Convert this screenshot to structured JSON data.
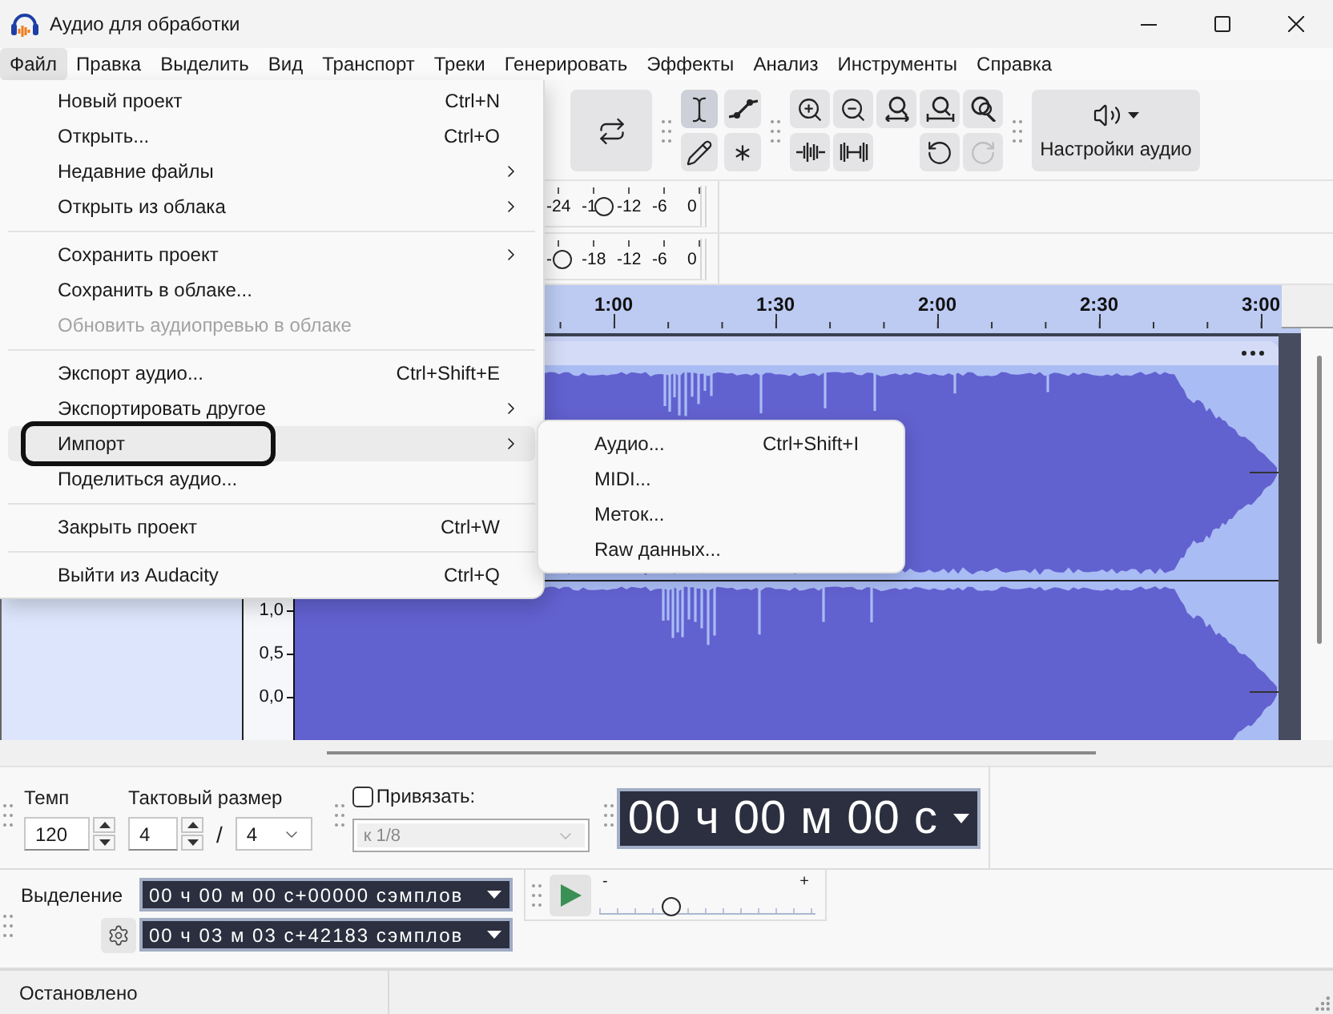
{
  "window": {
    "title": "Аудио для обработки"
  },
  "menu_bar": [
    {
      "label": "Файл",
      "selected": true
    },
    {
      "label": "Правка",
      "selected": false
    },
    {
      "label": "Выделить",
      "selected": false
    },
    {
      "label": "Вид",
      "selected": false
    },
    {
      "label": "Транспорт",
      "selected": false
    },
    {
      "label": "Треки",
      "selected": false
    },
    {
      "label": "Генерировать",
      "selected": false
    },
    {
      "label": "Эффекты",
      "selected": false
    },
    {
      "label": "Анализ",
      "selected": false
    },
    {
      "label": "Инструменты",
      "selected": false
    },
    {
      "label": "Справка",
      "selected": false
    }
  ],
  "file_menu": {
    "items": [
      {
        "kind": "item",
        "label": "Новый проект",
        "shortcut": "Ctrl+N",
        "submenu": false,
        "disabled": false,
        "selected": false,
        "outlined": false
      },
      {
        "kind": "item",
        "label": "Открыть...",
        "shortcut": "Ctrl+O",
        "submenu": false,
        "disabled": false,
        "selected": false,
        "outlined": false
      },
      {
        "kind": "item",
        "label": "Недавние файлы",
        "submenu": true,
        "disabled": false,
        "selected": false,
        "outlined": false
      },
      {
        "kind": "item",
        "label": "Открыть из облака",
        "submenu": true,
        "disabled": false,
        "selected": false,
        "outlined": false
      },
      {
        "kind": "separator"
      },
      {
        "kind": "item",
        "label": "Сохранить проект",
        "submenu": true,
        "disabled": false,
        "selected": false,
        "outlined": false
      },
      {
        "kind": "item",
        "label": "Сохранить в облаке...",
        "submenu": false,
        "disabled": false,
        "selected": false,
        "outlined": false
      },
      {
        "kind": "item",
        "label": "Обновить аудиопревью в облаке",
        "submenu": false,
        "disabled": true,
        "selected": false,
        "outlined": false
      },
      {
        "kind": "separator"
      },
      {
        "kind": "item",
        "label": "Экспорт аудио...",
        "shortcut": "Ctrl+Shift+E",
        "submenu": false,
        "disabled": false,
        "selected": false,
        "outlined": false
      },
      {
        "kind": "item",
        "label": "Экспортировать другое",
        "submenu": true,
        "disabled": false,
        "selected": false,
        "outlined": false
      },
      {
        "kind": "item",
        "label": "Импорт",
        "submenu": true,
        "disabled": false,
        "selected": true,
        "outlined": true
      },
      {
        "kind": "item",
        "label": "Поделиться аудио...",
        "submenu": false,
        "disabled": false,
        "selected": false,
        "outlined": false
      },
      {
        "kind": "separator"
      },
      {
        "kind": "item",
        "label": "Закрыть проект",
        "shortcut": "Ctrl+W",
        "submenu": false,
        "disabled": false,
        "selected": false,
        "outlined": false
      },
      {
        "kind": "separator"
      },
      {
        "kind": "item",
        "label": "Выйти из Audacity",
        "shortcut": "Ctrl+Q",
        "submenu": false,
        "disabled": false,
        "selected": false,
        "outlined": false
      }
    ]
  },
  "import_submenu": {
    "items": [
      {
        "label": "Аудио...",
        "shortcut": "Ctrl+Shift+I"
      },
      {
        "label": "MIDI..."
      },
      {
        "label": "Меток..."
      },
      {
        "label": "Raw данных..."
      }
    ]
  },
  "toolbar": {
    "tools": [
      {
        "kind": "select",
        "selected": true
      },
      {
        "kind": "envelope",
        "selected": false
      },
      {
        "kind": "draw",
        "selected": false
      },
      {
        "kind": "multi",
        "selected": false
      }
    ],
    "zoom_buttons": [
      {
        "kind": "zoom-in",
        "disabled": false
      },
      {
        "kind": "zoom-out",
        "disabled": false
      },
      {
        "kind": "fit-selection",
        "disabled": false
      },
      {
        "kind": "fit-project",
        "disabled": false
      },
      {
        "kind": "zoom-toggle",
        "disabled": false
      }
    ],
    "edit_buttons": [
      {
        "kind": "trim",
        "disabled": false
      },
      {
        "kind": "silence",
        "disabled": false
      },
      {
        "kind": "undo",
        "disabled": false
      },
      {
        "kind": "redo",
        "disabled": true
      }
    ],
    "audio_setup": {
      "label": "Настройки аудио"
    }
  },
  "meters": [
    {
      "labels": [
        "-24",
        "-1",
        "-12",
        "-6",
        "0"
      ],
      "level": 0.404
    },
    {
      "labels": [
        "-",
        "-18",
        "-12",
        "-6",
        "0"
      ],
      "level": 0.144
    }
  ],
  "ruler": {
    "labels": [
      "1:00",
      "1:30",
      "2:00",
      "2:30",
      "3:00"
    ]
  },
  "track": {
    "scale_labels": [
      "1,0",
      "0,5",
      "0,0"
    ]
  },
  "tempo": {
    "label": "Темп",
    "value": "120"
  },
  "time_signature": {
    "label": "Тактовый размер",
    "upper": "4",
    "divider": "/",
    "lower": "4"
  },
  "snap": {
    "label": "Привязать:",
    "checked": false,
    "value": "к 1/8",
    "disabled": true
  },
  "time_display": {
    "value": "00 ч 00 м 00 с"
  },
  "selection": {
    "label": "Выделение",
    "start": "00 ч 00 м 00 с+00000 сэмплов",
    "end": "00 ч 03 м 03 с+42183 сэмплов"
  },
  "play_speed": {
    "min_label": "-",
    "max_label": "+",
    "level": 0.33
  },
  "status_bar": {
    "text": "Остановлено"
  }
}
